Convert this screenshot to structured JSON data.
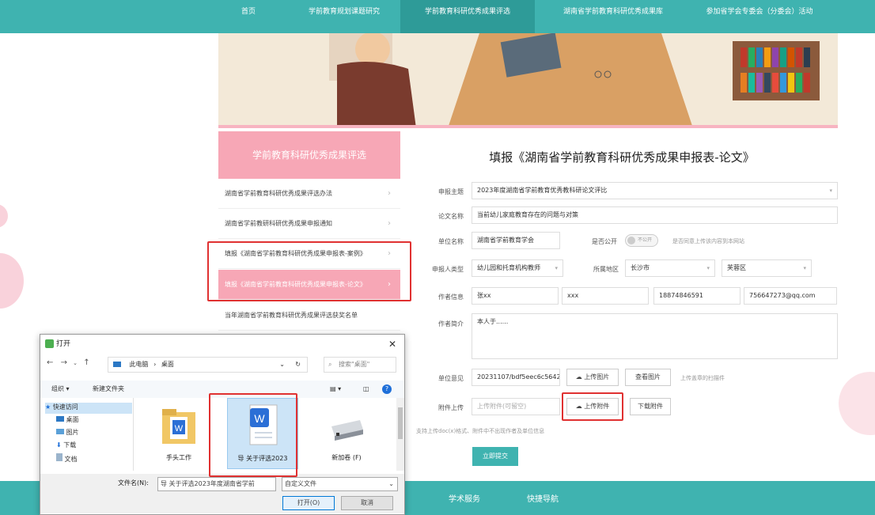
{
  "nav": {
    "items": [
      "首页",
      "学前教育规划课题研究",
      "学前教育科研优秀成果评选",
      "湖南省学前教育科研优秀成果库",
      "参加省学会专委会（分委会）活动"
    ]
  },
  "sidebar": {
    "title": "学前教育科研优秀成果评选",
    "items": [
      "湖南省学前教育科研优秀成果评选办法",
      "湖南省学前教研科研优秀成果申报通知",
      "填报《湖南省学前教育科研优秀成果申报表-案例》",
      "填报《湖南省学前教育科研优秀成果申报表-论文》",
      "当年湖南省学前教育科研优秀成果评选获奖名单"
    ]
  },
  "form": {
    "title": "填报《湖南省学前教育科研优秀成果申报表-论文》",
    "labels": {
      "theme": "申报主题",
      "paper_name": "论文名称",
      "unit_name": "单位名称",
      "public": "是否公开",
      "applicant_type": "申报人类型",
      "region": "所属地区",
      "author_info": "作者信息",
      "author_bio": "作者简介",
      "unit_opinion": "单位意见",
      "attachment": "附件上传"
    },
    "values": {
      "theme": "2023年度湖南省学前教育优秀教科研论文评比",
      "paper_name": "当前幼儿家庭教育存在的问题与对策",
      "unit_name": "湖南省学前教育学会",
      "public_toggle": "不公开",
      "public_note": "是否同意上传该内容到本网站",
      "applicant_type": "幼儿园和托育机构教师",
      "city": "长沙市",
      "district": "芙蓉区",
      "author_name": "张xx",
      "author_unit": "xxx",
      "author_phone": "18874846591",
      "author_email": "756647273@qq.com",
      "author_bio": "本人于......",
      "unit_opinion_file": "20231107/bdf5eec6c56429",
      "attachment_placeholder": "上传附件(可留空)",
      "attachment_note": "支持上传doc(x)格式、附件中不出现作者及单位信息"
    },
    "buttons": {
      "upload_image": "上传图片",
      "view_image": "查看图片",
      "upload_image_note": "上传盖章的扫描件",
      "upload_attachment": "上传附件",
      "download_attachment": "下载附件",
      "submit": "立即提交"
    }
  },
  "footer": {
    "items": [
      "学术服务",
      "快捷导航"
    ]
  },
  "dialog": {
    "title": "打开",
    "path": [
      "此电脑",
      "桌面"
    ],
    "search_placeholder": "搜索\"桌面\"",
    "toolbar": {
      "organize": "组织 ▾",
      "new_folder": "新建文件夹"
    },
    "nav_items": [
      "快速访问",
      "桌面",
      "图片",
      "下载",
      "文档"
    ],
    "files": [
      "手头工作",
      "导 关于评选2023",
      "新加卷 (F)"
    ],
    "filename_label": "文件名(N):",
    "filename": "导 关于评选2023年度湖南省学前",
    "filetype": "自定义文件",
    "open": "打开(O)",
    "cancel": "取消"
  }
}
